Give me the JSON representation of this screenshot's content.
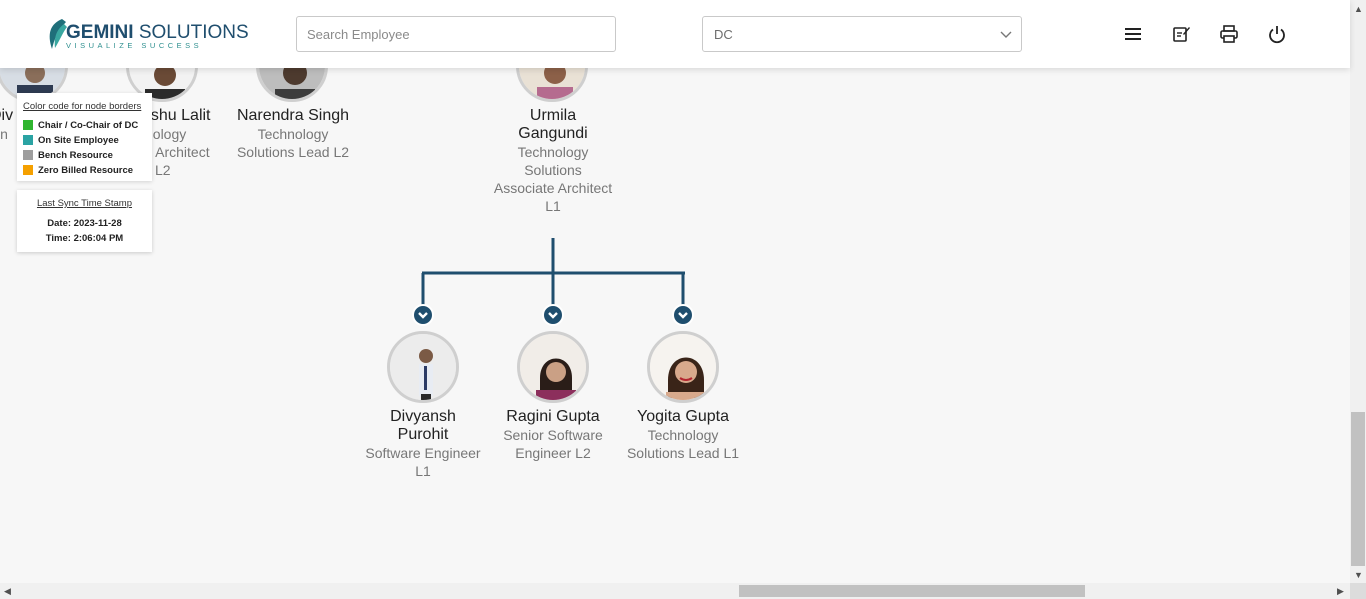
{
  "header": {
    "logo_word_bold": "GEMINI",
    "logo_word_rest": "SOLUTIONS",
    "logo_tagline": "VISUALIZE SUCCESS",
    "search_placeholder": "Search Employee",
    "selected_group": "DC",
    "icons": [
      "menu-icon",
      "edit-notes-icon",
      "print-icon",
      "power-icon"
    ]
  },
  "legend": {
    "title": "Color code for node borders",
    "items": [
      {
        "label": "Chair / Co-Chair of DC",
        "color": "#2fb52f"
      },
      {
        "label": "On Site Employee",
        "color": "#2aa3a3"
      },
      {
        "label": "Bench Resource",
        "color": "#9e9e9e"
      },
      {
        "label": "Zero Billed Resource",
        "color": "#f5a000"
      }
    ]
  },
  "sync": {
    "title": "Last Sync Time Stamp",
    "date": "Date: 2023-11-28",
    "time": "Time: 2:06:04 PM"
  },
  "top_nodes": [
    {
      "name": "Div",
      "title": "sin"
    },
    {
      "name": "nshu Lalit",
      "title_lines": [
        "nology",
        "s Architect",
        "L2"
      ]
    },
    {
      "name": "Narendra Singh",
      "title_lines": [
        "Technology",
        "Solutions Lead L2"
      ]
    },
    {
      "name_lines": [
        "Urmila",
        "Gangundi"
      ],
      "title_lines": [
        "Technology",
        "Solutions",
        "Associate Architect",
        "L1"
      ]
    }
  ],
  "child_nodes": [
    {
      "name_lines": [
        "Divyansh",
        "Purohit"
      ],
      "title_lines": [
        "Software Engineer",
        "L1"
      ]
    },
    {
      "name_lines": [
        "Ragini Gupta"
      ],
      "title_lines": [
        "Senior Software",
        "Engineer L2"
      ]
    },
    {
      "name_lines": [
        "Yogita Gupta"
      ],
      "title_lines": [
        "Technology",
        "Solutions Lead L1"
      ]
    }
  ],
  "colors": {
    "brand": "#1f4e6e",
    "connector": "#1f4e6e",
    "node_border": "#cfcfcf"
  }
}
